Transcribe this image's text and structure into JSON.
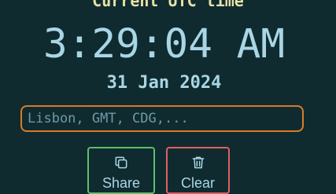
{
  "heading": "Current UTC time",
  "time": "3:29:04 AM",
  "date": "31 Jan 2024",
  "search": {
    "placeholder": "Lisbon, GMT, CDG,..."
  },
  "buttons": {
    "share": {
      "label": "Share",
      "icon": "copy-icon"
    },
    "clear": {
      "label": "Clear",
      "icon": "trash-icon"
    }
  },
  "colors": {
    "background": "#0f2b30",
    "heading": "#e8e2a6",
    "text": "#a9d6e5",
    "input_border": "#d97b2a",
    "share_border": "#5fbf6a",
    "clear_border": "#e06060"
  }
}
